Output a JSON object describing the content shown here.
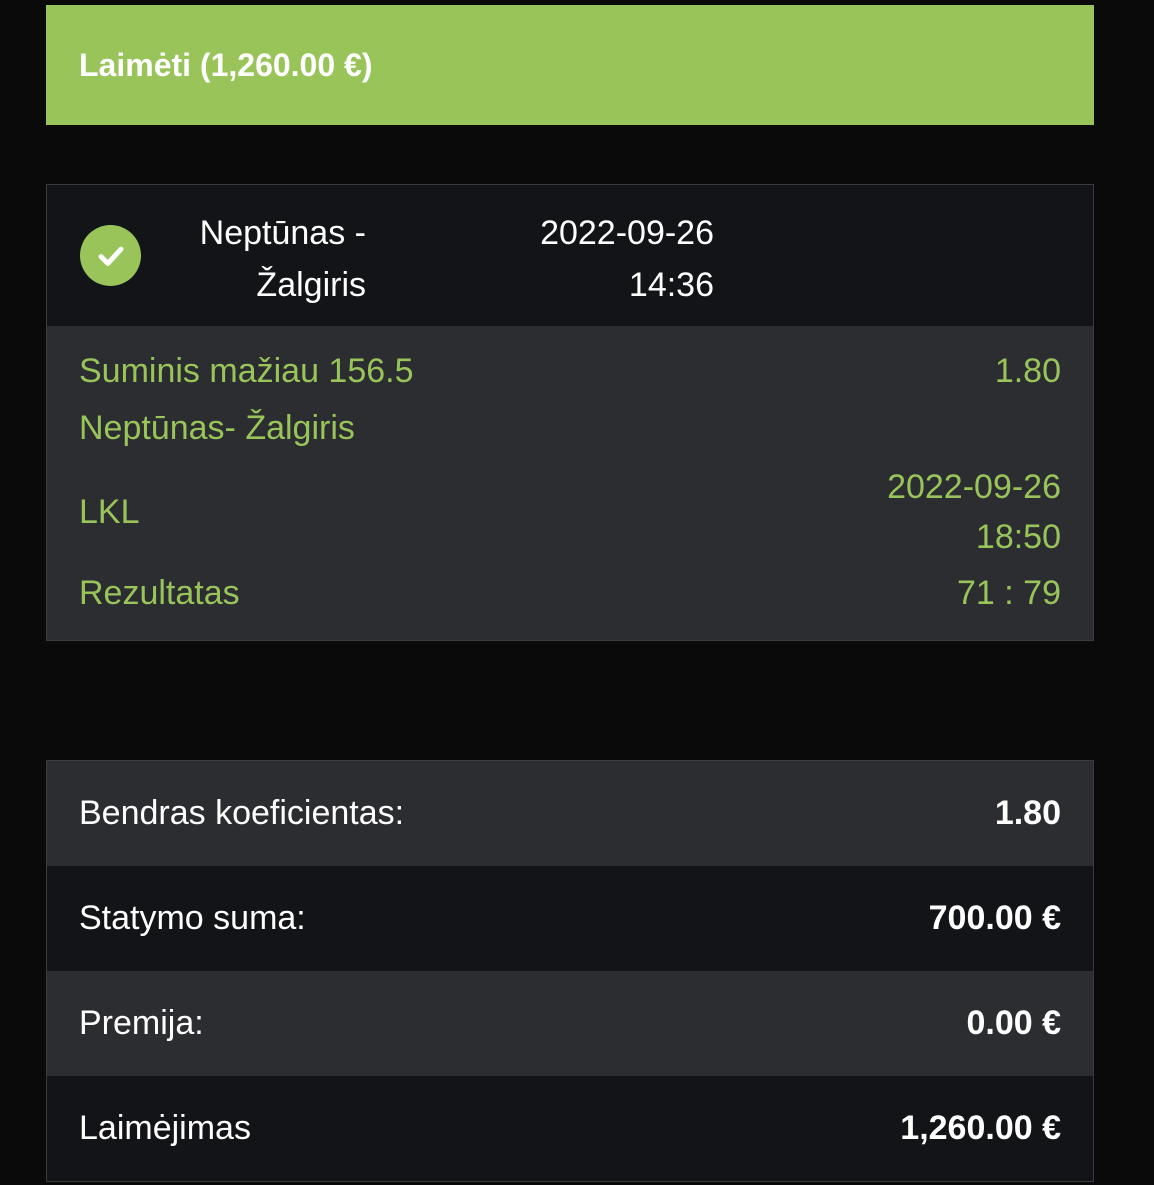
{
  "banner": {
    "label": "Laimėti (1,260.00 €)"
  },
  "event": {
    "status_icon": "check-circle-icon",
    "teams_line1": "Neptūnas -",
    "teams_line2": "Žalgiris",
    "date": "2022-09-26",
    "time": "14:36",
    "market": "Suminis mažiau 156.5",
    "odds": "1.80",
    "match": "Neptūnas- Žalgiris",
    "league": "LKL",
    "match_date": "2022-09-26",
    "match_time": "18:50",
    "result_label": "Rezultatas",
    "result_value": "71 : 79"
  },
  "summary": [
    {
      "label": "Bendras koeficientas:",
      "value": "1.80"
    },
    {
      "label": "Statymo suma:",
      "value": "700.00 €"
    },
    {
      "label": "Premija:",
      "value": "0.00 €"
    },
    {
      "label": "Laimėjimas",
      "value": "1,260.00 €"
    }
  ],
  "colors": {
    "accent": "#98c45a",
    "background": "#0a0a0a",
    "row_light": "#2c2d30",
    "row_dark": "#131417"
  }
}
